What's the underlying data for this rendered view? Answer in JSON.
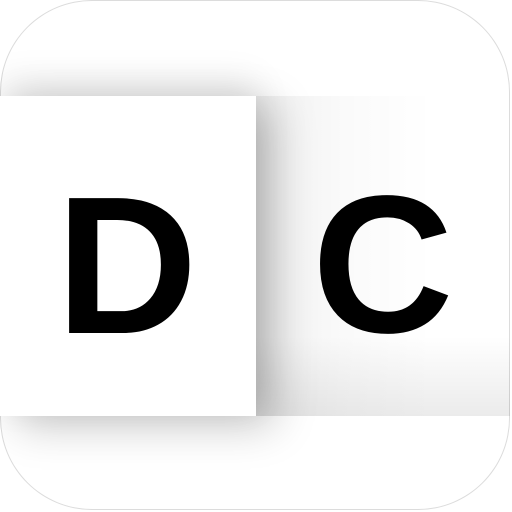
{
  "icon": {
    "letters": {
      "left": "D",
      "right": "C"
    },
    "colors": {
      "background": "#ffffff",
      "letter": "#000000",
      "border": "#dcdcdc"
    }
  }
}
